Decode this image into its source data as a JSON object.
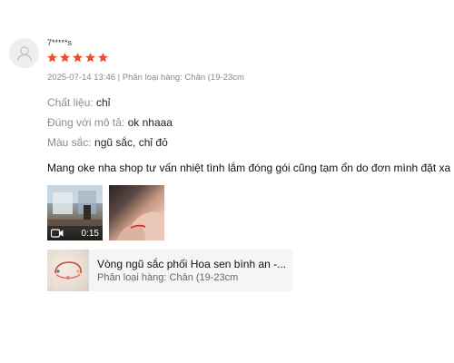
{
  "review": {
    "username": "7*****s",
    "rating": 5,
    "star_color": "#ee4d2d",
    "meta": "2025-07-14 13:46 | Phân loại hàng: Chân (19-23cm",
    "attributes": [
      {
        "label": "Chất liệu:",
        "value": "chỉ"
      },
      {
        "label": "Đúng với mô tả:",
        "value": "ok nhaaa"
      },
      {
        "label": "Màu sắc:",
        "value": "ngũ sắc, chỉ đỏ"
      }
    ],
    "comment": "Mang oke nha shop tư vấn nhiệt tình lắm đóng gói cũng tạm ổn do đơn mình đặt xa",
    "media": {
      "video_duration": "0:15",
      "video_icon": "video-camera-icon",
      "photo_alt": "review-photo"
    }
  },
  "product": {
    "name": "Vòng ngũ sắc phối Hoa sen bình an -...",
    "variant": "Phân loại hàng: Chân (19-23cm"
  }
}
